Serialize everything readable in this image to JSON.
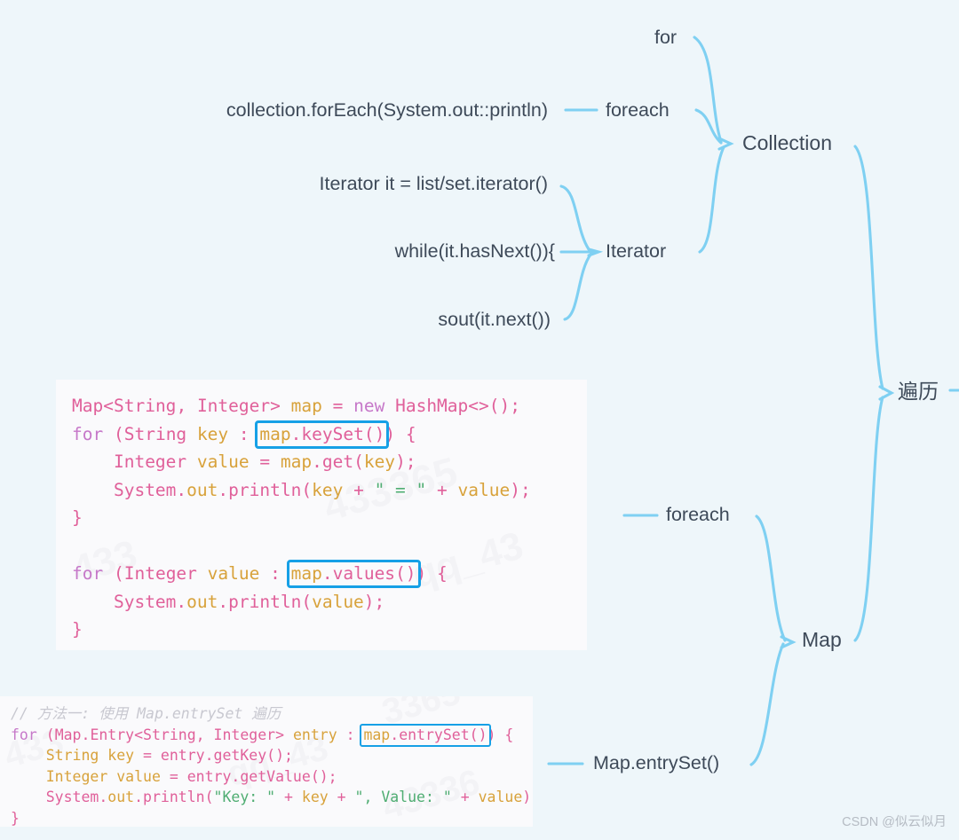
{
  "background_color": "#eef6fa",
  "accent_color": "#7fd0f2",
  "highlight_box_color": "#16a0e6",
  "text_color": "#3e4a59",
  "mindmap": {
    "root": "遍历",
    "branches": [
      {
        "label": "Collection",
        "children": [
          {
            "label": "for",
            "leaves": []
          },
          {
            "label": "foreach",
            "leaves": [
              "collection.forEach(System.out::println)"
            ]
          },
          {
            "label": "Iterator",
            "leaves": [
              "Iterator it = list/set.iterator()",
              "while(it.hasNext()){",
              "sout(it.next())"
            ]
          }
        ]
      },
      {
        "label": "Map",
        "children": [
          {
            "label": "foreach",
            "leaves": []
          },
          {
            "label": "Map.entrySet()",
            "leaves": []
          }
        ]
      }
    ]
  },
  "code_blocks": [
    {
      "id": "map-foreach-sample",
      "language": "java",
      "lines": [
        "Map<String, Integer> map = new HashMap<>();",
        "for (String key : map.keySet()) {",
        "    Integer value = map.get(key);",
        "    System.out.println(key + \" = \" + value);",
        "}",
        "",
        "for (Integer value : map.values()) {",
        "    System.out.println(value);",
        "}"
      ],
      "highlights": [
        "map.keySet()",
        "map.values()"
      ],
      "watermarks": [
        "qq_43336",
        "qq_43336",
        "433"
      ]
    },
    {
      "id": "map-entryset-sample",
      "language": "java",
      "lines": [
        "// 方法一: 使用 Map.entrySet 遍历",
        "for (Map.Entry<String, Integer> entry : map.entrySet()) {",
        "    String key = entry.getKey();",
        "    Integer value = entry.getValue();",
        "    System.out.println(\"Key: \" + key + \", Value: \" + value);",
        "}"
      ],
      "highlights": [
        "map.entrySet()"
      ],
      "watermarks": [
        "433",
        "qq_43",
        "43336"
      ]
    }
  ],
  "watermark": "CSDN @似云似月"
}
